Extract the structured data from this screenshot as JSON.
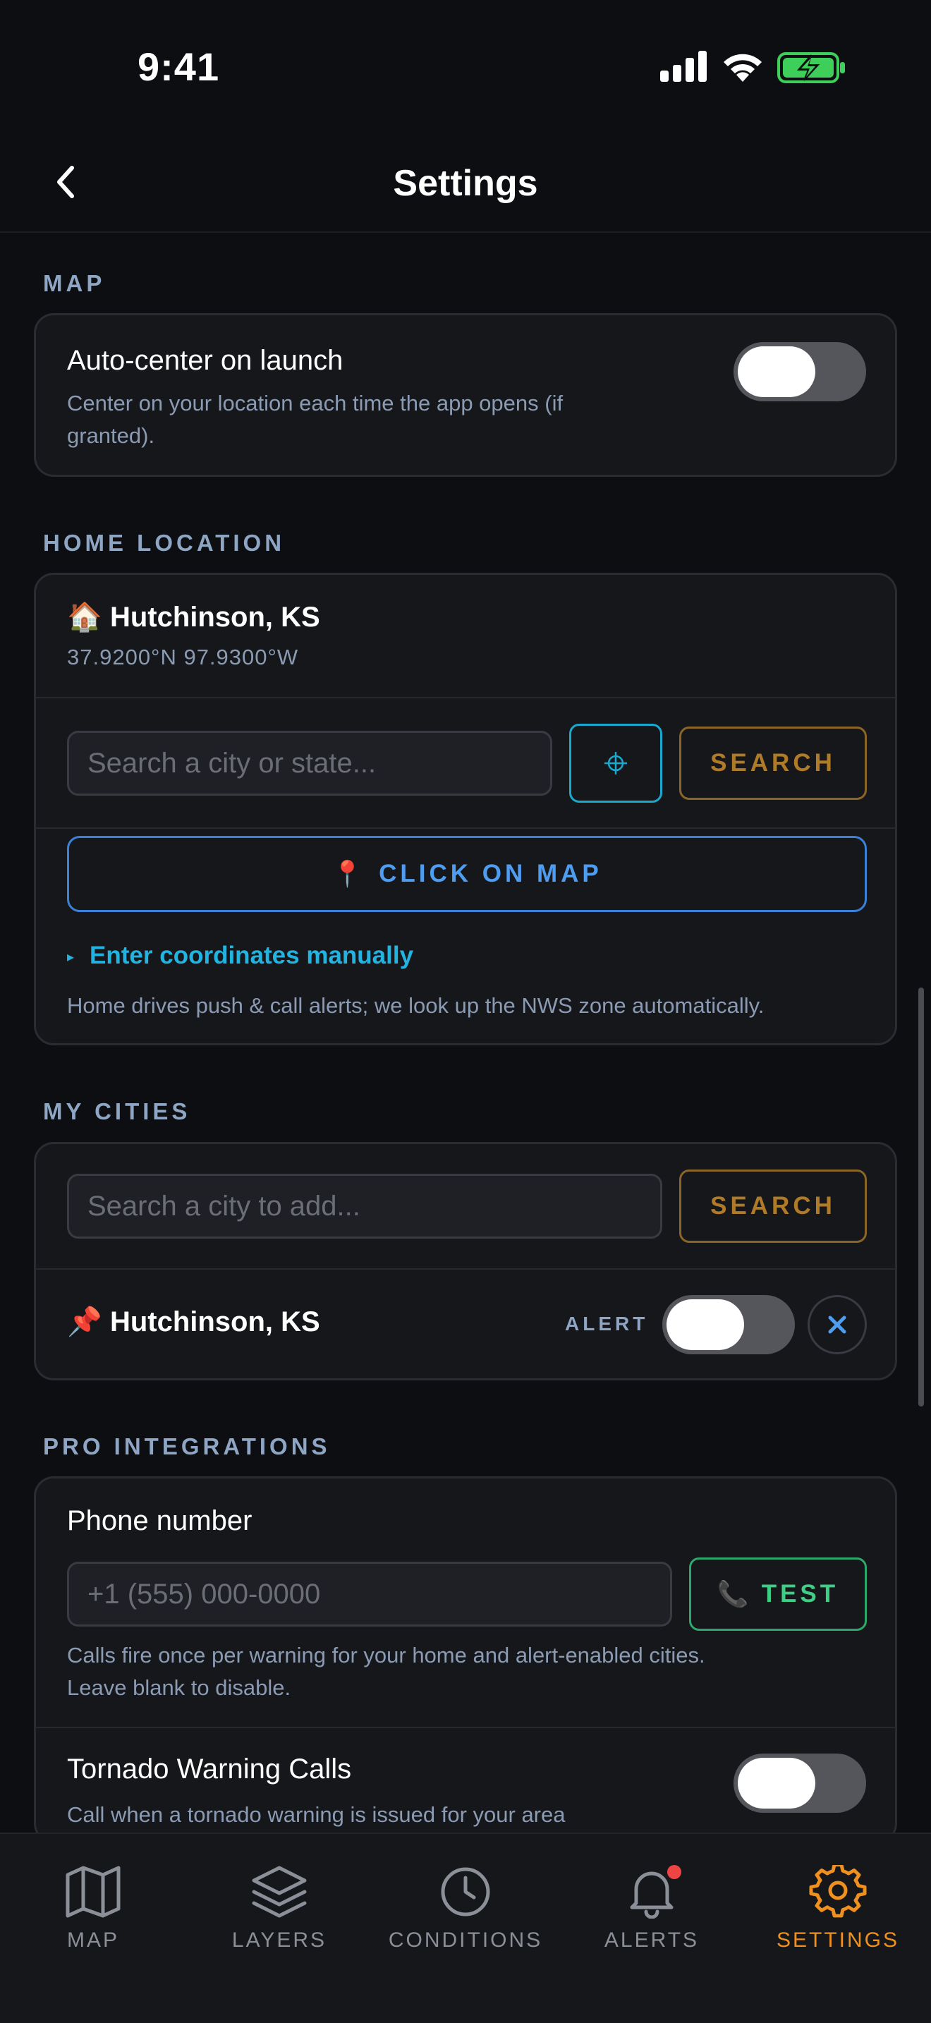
{
  "status_bar": {
    "time": "9:41"
  },
  "nav": {
    "title": "Settings"
  },
  "map_section": {
    "label": "MAP",
    "auto_center": {
      "title": "Auto-center on launch",
      "description_line1": "Center on your location each time the app opens (if",
      "description_line2": "granted).",
      "enabled": false
    }
  },
  "home_section": {
    "label": "HOME LOCATION",
    "city_emoji": "🏠",
    "city": "Hutchinson, KS",
    "coordinates": "37.9200°N  97.9300°W",
    "search_placeholder": "Search a city or state...",
    "search_button": "SEARCH",
    "map_pin_emoji": "📍",
    "click_on_map_button": "CLICK ON MAP",
    "manual_link_marker": "▸",
    "manual_link": "Enter coordinates manually",
    "note": "Home drives push & call alerts; we look up the NWS zone automatically."
  },
  "cities_section": {
    "label": "MY CITIES",
    "search_placeholder": "Search a city to add...",
    "search_button": "SEARCH",
    "cities": [
      {
        "emoji": "📌",
        "name": "Hutchinson, KS",
        "alert_label": "ALERT",
        "alert_enabled": false
      }
    ]
  },
  "pro_section": {
    "label": "PRO INTEGRATIONS",
    "phone": {
      "title": "Phone number",
      "placeholder": "+1 (555) 000-0000",
      "phone_emoji": "📞",
      "test_button": "TEST",
      "description_line1": "Calls fire once per warning for your home and alert-enabled cities.",
      "description_line2": "Leave blank to disable."
    },
    "tornado": {
      "title": "Tornado Warning Calls",
      "description": "Call when a tornado warning is issued for your area",
      "enabled": false
    }
  },
  "tab_bar": {
    "tabs": [
      {
        "label": "MAP",
        "icon": "map-icon"
      },
      {
        "label": "LAYERS",
        "icon": "layers-icon"
      },
      {
        "label": "CONDITIONS",
        "icon": "clock-icon"
      },
      {
        "label": "ALERTS",
        "icon": "bell-icon"
      },
      {
        "label": "SETTINGS",
        "icon": "gear-icon"
      }
    ],
    "active_tab": "SETTINGS",
    "accent_color": "#f0901f"
  }
}
